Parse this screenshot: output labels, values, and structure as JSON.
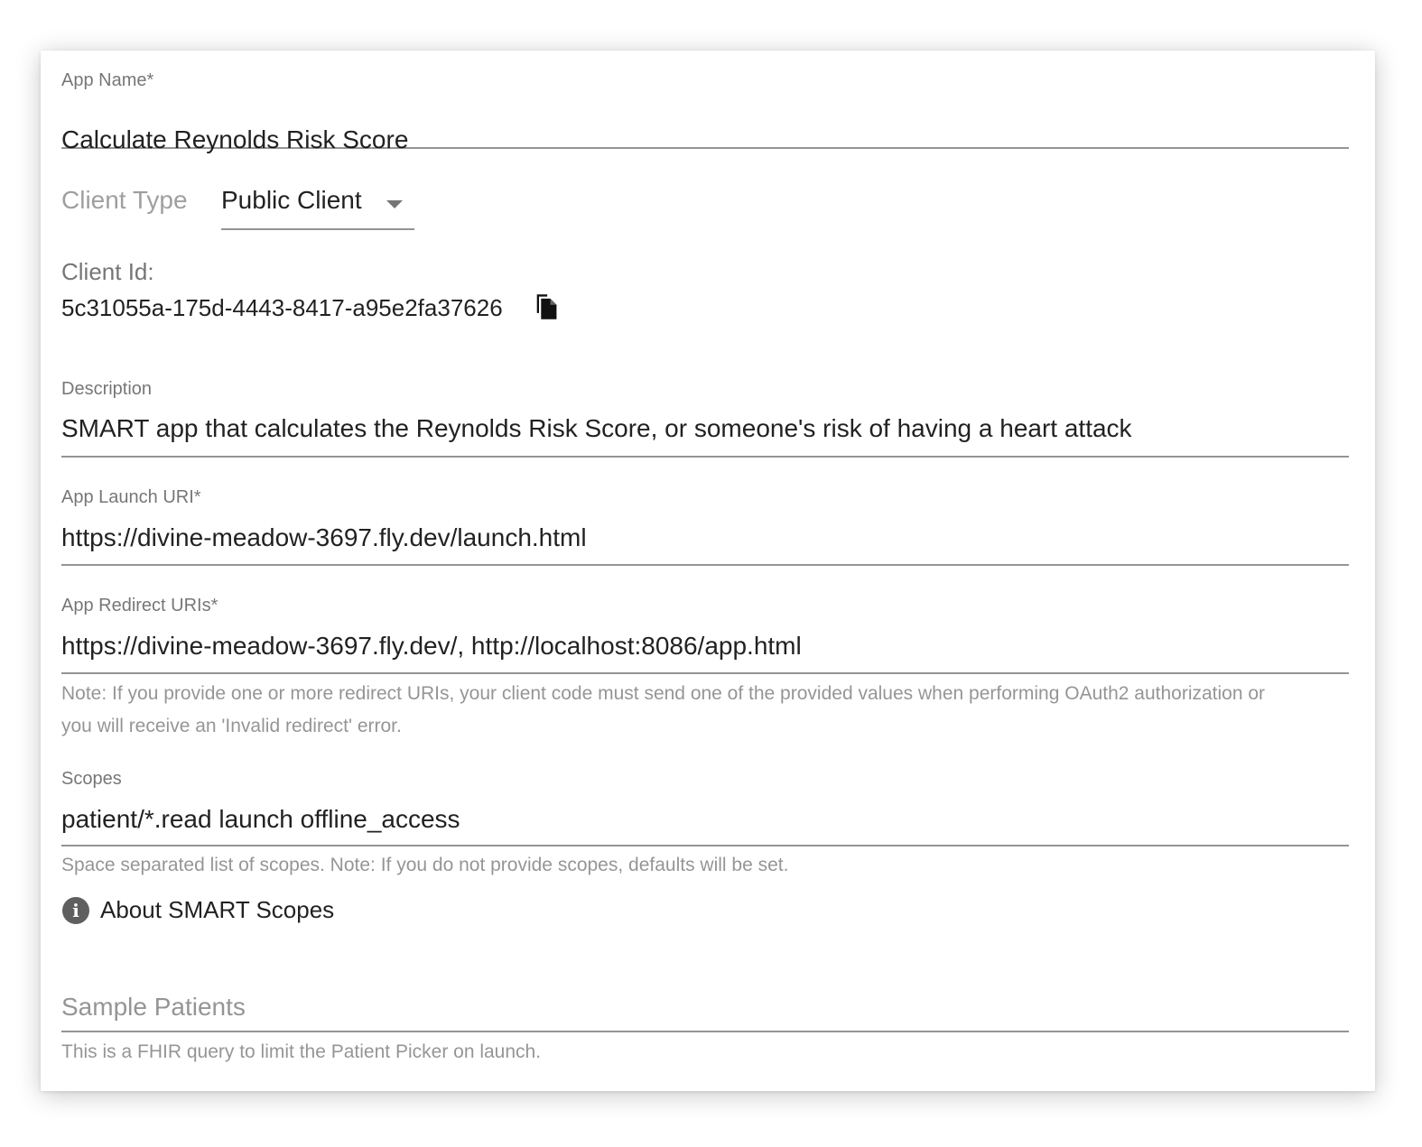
{
  "app_name": {
    "label": "App Name*",
    "value": "Calculate Reynolds Risk Score"
  },
  "client_type": {
    "label": "Client Type",
    "selected": "Public Client"
  },
  "client_id": {
    "label": "Client Id:",
    "value": "5c31055a-175d-4443-8417-a95e2fa37626"
  },
  "description": {
    "label": "Description",
    "value": "SMART app that calculates the Reynolds Risk Score, or someone's risk of having a heart attack"
  },
  "launch_uri": {
    "label": "App Launch URI*",
    "value": "https://divine-meadow-3697.fly.dev/launch.html"
  },
  "redirect_uris": {
    "label": "App Redirect URIs*",
    "value": "https://divine-meadow-3697.fly.dev/, http://localhost:8086/app.html",
    "helper": "Note: If you provide one or more redirect URIs, your client code must send one of the provided values when performing OAuth2 authorization or you will receive an 'Invalid redirect' error."
  },
  "scopes": {
    "label": "Scopes",
    "value": "patient/*.read launch offline_access",
    "helper": "Space separated list of scopes. Note: If you do not provide scopes, defaults will be set."
  },
  "about_scopes": {
    "label": "About SMART Scopes",
    "icon": "info-icon"
  },
  "sample_patients": {
    "placeholder": "Sample Patients",
    "value": "",
    "helper": "This is a FHIR query to limit the Patient Picker on launch."
  },
  "icons": {
    "copy": "copy-icon",
    "dropdown": "chevron-down-icon",
    "info": "info-icon"
  }
}
